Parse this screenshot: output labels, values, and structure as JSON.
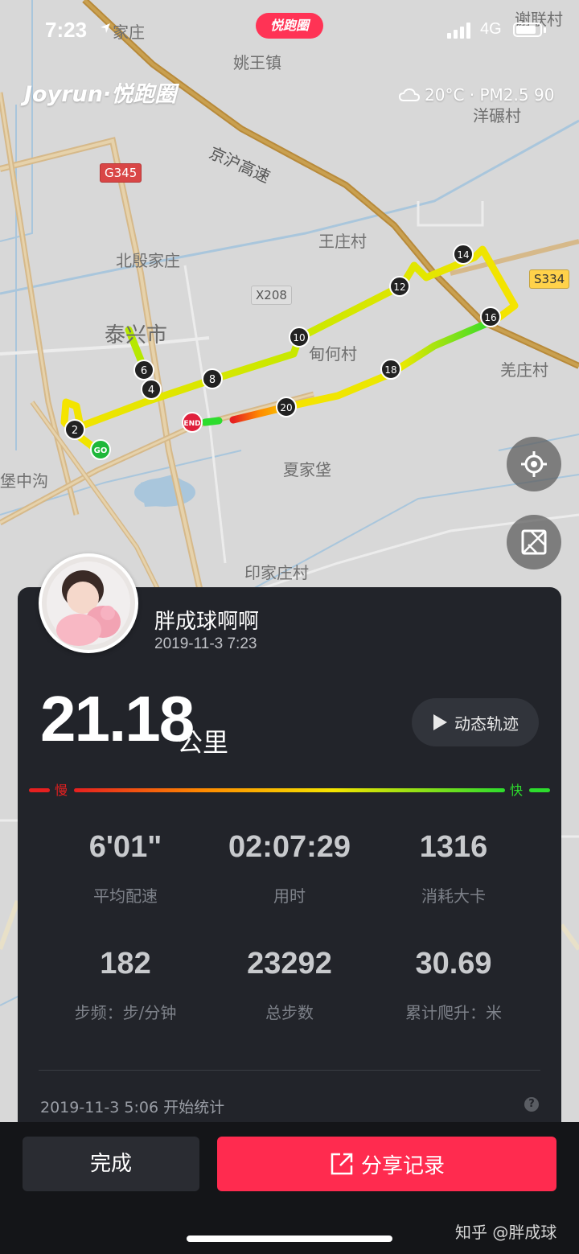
{
  "status_bar": {
    "time": "7:23",
    "network": "4G",
    "battery_level": 0.85
  },
  "header": {
    "brand_badge": "悦跑圈",
    "logo": "Joyrun·悦跑圈",
    "weather_icon": "cloud-icon",
    "weather_text": "20°C · PM2.5 90"
  },
  "map": {
    "place_labels": [
      "谢联村",
      "家庄",
      "姚王镇",
      "京沪高速",
      "洋碾村",
      "王庄村",
      "北殷家庄",
      "泰兴市",
      "甸何村",
      "羌庄村",
      "夏家垡",
      "堡中沟",
      "印家庄村"
    ],
    "road_badges": [
      "G345",
      "X208",
      "S334"
    ],
    "km_markers": [
      "2",
      "4",
      "6",
      "8",
      "10",
      "12",
      "14",
      "16",
      "18",
      "20"
    ],
    "start_label": "GO",
    "end_label": "END"
  },
  "profile": {
    "username": "胖成球啊啊",
    "datetime": "2019-11-3 7:23"
  },
  "summary": {
    "distance": "21.18",
    "distance_unit": "公里",
    "track_button": "动态轨迹",
    "slow_label": "慢",
    "fast_label": "快"
  },
  "stats": [
    {
      "value": "6'01\"",
      "label": "平均配速"
    },
    {
      "value": "02:07:29",
      "label": "用时"
    },
    {
      "value": "1316",
      "label": "消耗大卡"
    },
    {
      "value": "182",
      "label": "步频：步/分钟"
    },
    {
      "value": "23292",
      "label": "总步数"
    },
    {
      "value": "30.69",
      "label": "累计爬升：米"
    }
  ],
  "footer": {
    "start_time": "2019-11-3 5:06 开始统计",
    "help": "?",
    "done_button": "完成",
    "share_button": "分享记录"
  },
  "watermark": "知乎 @胖成球",
  "colors": {
    "accent": "#ff2b4f",
    "panel": "#22242a",
    "route_slow": "#e62020",
    "route_mid": "#f5e400",
    "route_fast": "#2ddc2d"
  }
}
